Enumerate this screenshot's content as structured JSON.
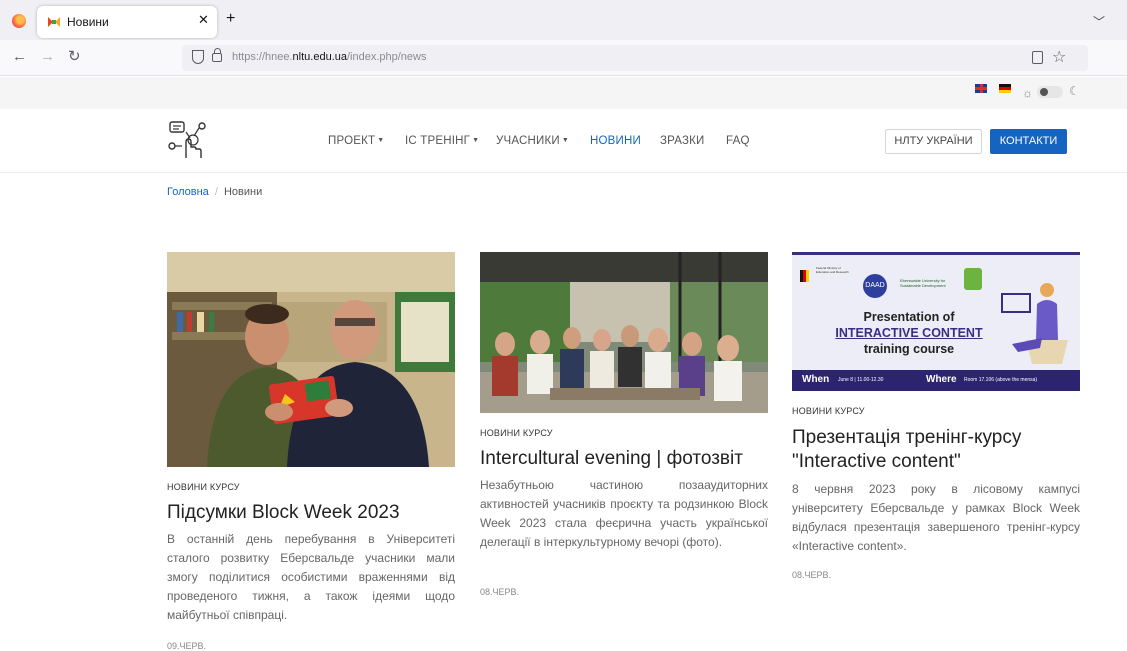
{
  "browser": {
    "tab_title": "Новини",
    "url_prefix": "https://hnee.",
    "url_domain": "nltu.edu.ua",
    "url_path": "/index.php/news",
    "icons": [
      "firefox-icon",
      "close-icon",
      "plus-icon",
      "chevron-down-icon",
      "back-icon",
      "forward-icon",
      "reload-icon",
      "shield-icon",
      "lock-icon",
      "reader-icon",
      "star-icon"
    ]
  },
  "topbar": {
    "languages": [
      "uk-flag-icon",
      "de-flag-icon"
    ],
    "theme_icons": [
      "sun-icon",
      "moon-icon"
    ]
  },
  "site_nav": {
    "items": [
      {
        "label": "ПРОЕКТ",
        "dropdown": true
      },
      {
        "label": "ІС ТРЕНІНГ",
        "dropdown": true
      },
      {
        "label": "УЧАСНИКИ",
        "dropdown": true
      },
      {
        "label": "НОВИНИ",
        "dropdown": false,
        "active": true
      },
      {
        "label": "ЗРАЗКИ",
        "dropdown": false
      },
      {
        "label": "FAQ",
        "dropdown": false
      }
    ],
    "nltu_button": "НЛТУ УКРАЇНИ",
    "contacts_button": "КОНТАКТИ",
    "accent": "#1565c0"
  },
  "breadcrumb": {
    "home": "Головна",
    "separator": "/",
    "current": "Новини"
  },
  "articles": [
    {
      "category": "НОВИНИ КУРСУ",
      "title": "Підсумки Block Week 2023",
      "text": "В останній день перебування в Університеті сталого розвитку Еберсвальде учасники мали змогу поділитися особистими враженнями від проведеного тижня, а також ідеями щодо майбутньої співпраці.",
      "date": "09.ЧЕРВ."
    },
    {
      "category": "НОВИНИ КУРСУ",
      "title": "Intercultural evening | фотозвіт",
      "text": "Незабутньою частиною позааудиторних активностей учасників проєкту та родзинкою Block Week 2023 стала феєрична участь української делегації в інтеркультурному вечорі (фото).",
      "date": "08.ЧЕРВ."
    },
    {
      "category": "НОВИНИ КУРСУ",
      "title": "Презентація тренінг-курсу \"Interactive content\"",
      "text": "8 червня 2023 року в лісовому кампусі університету Еберсвальде у рамках Block Week відбулася презентація завершеного тренінг-курсу «Interactive content».",
      "date": "08.ЧЕРВ."
    }
  ],
  "poster": {
    "logo1": "Federal Ministry of Education and Research",
    "logo2": "DAAD",
    "logo3": "Eberswalde University for Sustainable Development",
    "line1": "Presentation of",
    "line2": "INTERACTIVE CONTENT",
    "line3": "training course",
    "when_label": "When",
    "when_value": "June 8 | 11.00-12.30",
    "where_label": "Where",
    "where_value": "Room 17.106 (above the mensa)"
  }
}
